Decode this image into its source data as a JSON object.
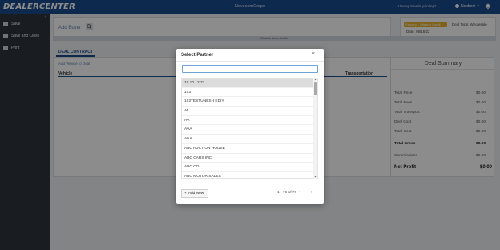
{
  "header": {
    "logo": "DEALERCENTER",
    "company": "NovecomCorpo",
    "trouble_text": "Having trouble printing?",
    "user_name": "Nexbeni"
  },
  "sidebar": {
    "items": [
      {
        "label": "Save",
        "icon": "save-icon"
      },
      {
        "label": "Save and Close",
        "icon": "save-close-icon"
      },
      {
        "label": "Print",
        "icon": "print-icon"
      }
    ]
  },
  "main": {
    "add_buyer": "Add Buyer",
    "status_badge": "Pending - Missing Credit",
    "deal_type": "Deal Type: Wholesale",
    "date": "Date: 08/16/22",
    "click_to_view": "Click to view details",
    "tab_label": "DEAL CONTRACT",
    "add_vehicle": "Add Vehicle to Deal",
    "vehicle_header": "Vehicle",
    "transportation_header": "Transportation"
  },
  "summary": {
    "title": "Deal Summary",
    "rows": [
      {
        "label": "Total Price",
        "value": "$0.00"
      },
      {
        "label": "Total Fees",
        "value": "$0.00"
      },
      {
        "label": "Total Transport",
        "value": "$0.00"
      },
      {
        "label": "Deal Cost",
        "value": "$0.00"
      },
      {
        "label": "Total Cost",
        "value": "$0.00"
      },
      {
        "label": "Total Gross",
        "value": "$0.00"
      },
      {
        "label": "Commissions",
        "value": "$0.00"
      },
      {
        "label": "Net Profit",
        "value": "$0.00"
      }
    ]
  },
  "modal": {
    "title": "Select Partner",
    "close": "×",
    "search_value": "",
    "partners": [
      "10.10.12.27",
      "123",
      "123TESTUNESH EDIY",
      "A1",
      "AA",
      "AAA",
      "AAA",
      "ABC AUCTION HOUSE",
      "ABC CARS INC",
      "ABC CO",
      "ABC MOTOR SALES"
    ],
    "add_new_label": "Add New",
    "pagination": "1 - 76 of 76",
    "prev": "‹",
    "next": "›"
  },
  "colors": {
    "topbar": "#1a4b8f",
    "sidebar": "#2e353d",
    "accent": "#1a4b8f",
    "status_badge": "#e8b22d"
  }
}
